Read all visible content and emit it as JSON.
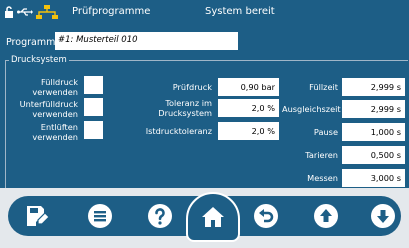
{
  "header": {
    "title": "Prüfprogramme",
    "status": "System bereit"
  },
  "program": {
    "label": "Programm",
    "value": "#1: Musterteil 010"
  },
  "group": {
    "title": "Drucksystem"
  },
  "checkboxes": [
    {
      "label_line1": "Fülldruck",
      "label_line2": "verwenden",
      "checked": false
    },
    {
      "label_line1": "Unterfülldruck",
      "label_line2": "verwenden",
      "checked": false
    },
    {
      "label_line1": "Entlüften",
      "label_line2": "verwenden",
      "checked": false
    }
  ],
  "params_mid": [
    {
      "label_line1": "Prüfdruck",
      "label_line2": "",
      "value": "0,90 bar"
    },
    {
      "label_line1": "Toleranz im",
      "label_line2": "Drucksystem",
      "value": "2,0 %"
    },
    {
      "label_line1": "Istdrucktoleranz",
      "label_line2": "",
      "value": "2,0 %"
    }
  ],
  "params_right": [
    {
      "label": "Füllzeit",
      "value": "2,999 s"
    },
    {
      "label": "Ausgleichszeit",
      "value": "2,999 s"
    },
    {
      "label": "Pause",
      "value": "1,000 s"
    },
    {
      "label": "Tarieren",
      "value": "0,500 s"
    },
    {
      "label": "Messen",
      "value": "3,000 s"
    }
  ],
  "toolbar": {
    "icons": [
      "save-edit-icon",
      "menu-icon",
      "help-icon",
      "home-icon",
      "undo-icon",
      "arrow-up-icon",
      "arrow-down-icon"
    ]
  },
  "colors": {
    "primary": "#1d5e86",
    "background": "#e9edf0",
    "accent_usb": "#f4c20d"
  }
}
